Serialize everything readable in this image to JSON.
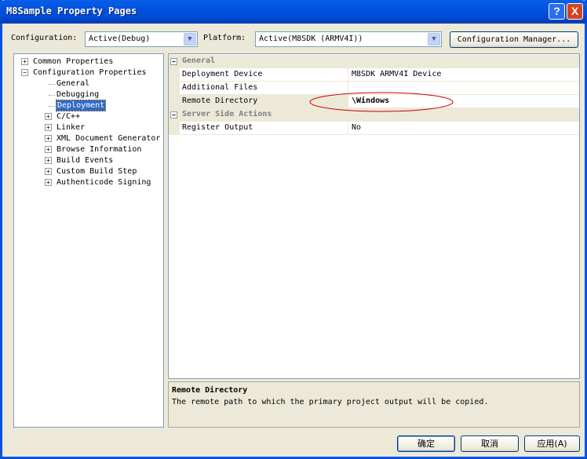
{
  "window": {
    "title": "M8Sample Property Pages",
    "help": "?",
    "close": "X"
  },
  "toolbar": {
    "configuration_label": "Configuration:",
    "configuration_value": "Active(Debug)",
    "platform_label": "Platform:",
    "platform_value": "Active(M8SDK (ARMV4I))",
    "config_manager": "Configuration Manager..."
  },
  "tree": [
    {
      "label": "Common Properties",
      "level": 0,
      "expander": "+"
    },
    {
      "label": "Configuration Properties",
      "level": 0,
      "expander": "-"
    },
    {
      "label": "General",
      "level": 1,
      "expander": ""
    },
    {
      "label": "Debugging",
      "level": 1,
      "expander": ""
    },
    {
      "label": "Deployment",
      "level": 1,
      "expander": "",
      "selected": true
    },
    {
      "label": "C/C++",
      "level": 1,
      "expander": "+"
    },
    {
      "label": "Linker",
      "level": 1,
      "expander": "+"
    },
    {
      "label": "XML Document Generator",
      "level": 1,
      "expander": "+"
    },
    {
      "label": "Browse Information",
      "level": 1,
      "expander": "+"
    },
    {
      "label": "Build Events",
      "level": 1,
      "expander": "+"
    },
    {
      "label": "Custom Build Step",
      "level": 1,
      "expander": "+"
    },
    {
      "label": "Authenticode Signing",
      "level": 1,
      "expander": "+"
    }
  ],
  "grid": {
    "cat_general": "General",
    "rows_general": [
      {
        "name": "Deployment Device",
        "value": "M8SDK ARMV4I Device"
      },
      {
        "name": "Additional Files",
        "value": ""
      },
      {
        "name": "Remote Directory",
        "value": "\\Windows"
      }
    ],
    "cat_server": "Server Side Actions",
    "rows_server": [
      {
        "name": "Register Output",
        "value": "No"
      }
    ],
    "highlight_color": "#cc0000"
  },
  "description": {
    "title": "Remote Directory",
    "text": "The remote path to which the primary project output will be copied."
  },
  "buttons": {
    "ok": "确定",
    "cancel": "取消",
    "apply": "应用(A)"
  }
}
